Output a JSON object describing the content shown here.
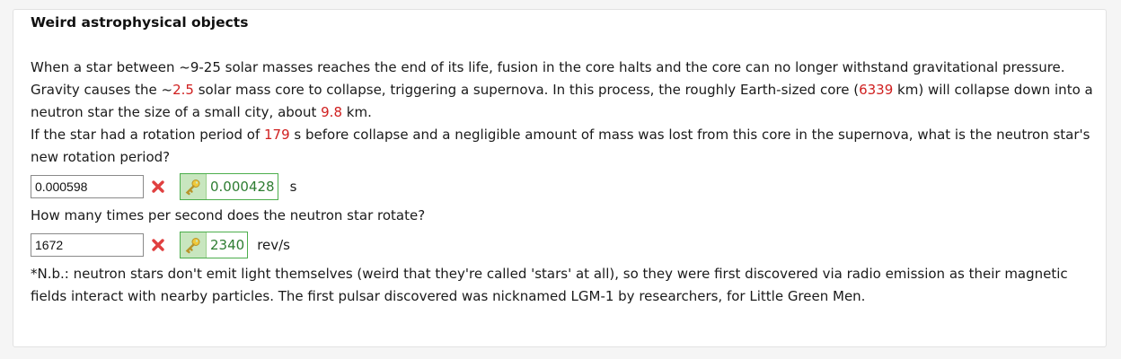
{
  "title": "Weird astrophysical objects",
  "intro": {
    "p1": "When a star between ~9-25 solar masses reaches the end of its life, fusion in the core halts and the core can no longer withstand gravitational pressure. Gravity causes the ~",
    "core_mass": "2.5",
    "p2": " solar mass core to collapse, triggering a supernova. In this process, the roughly Earth-sized core (",
    "core_size": "6339",
    "p3": " km) will collapse down into a neutron star the size of a small city, about ",
    "ns_size": "9.8",
    "p4": " km."
  },
  "question1": {
    "pre": "If the star had a rotation period of ",
    "period": "179",
    "post": " s before collapse and a negligible amount of mass was lost from this core in the supernova, what is the neutron star's new rotation period?",
    "input_value": "0.000598",
    "answer": "0.000428",
    "unit": "s"
  },
  "question2": {
    "text": "How many times per second does the neutron star rotate?",
    "input_value": "1672",
    "answer": "2340",
    "unit": "rev/s"
  },
  "note": "*N.b.: neutron stars don't emit light themselves (weird that they're called 'stars' at all), so they were first discovered via radio emission as their magnetic fields interact with nearby particles. The first pulsar discovered was nicknamed LGM-1 by researchers, for Little Green Men.",
  "icons": {
    "wrong": "x-mark-icon",
    "key": "key-icon"
  },
  "colors": {
    "highlight_number": "#d02020",
    "answer_border": "#4cae4c",
    "answer_text": "#2e7d32",
    "wrong_mark": "#e04040"
  }
}
